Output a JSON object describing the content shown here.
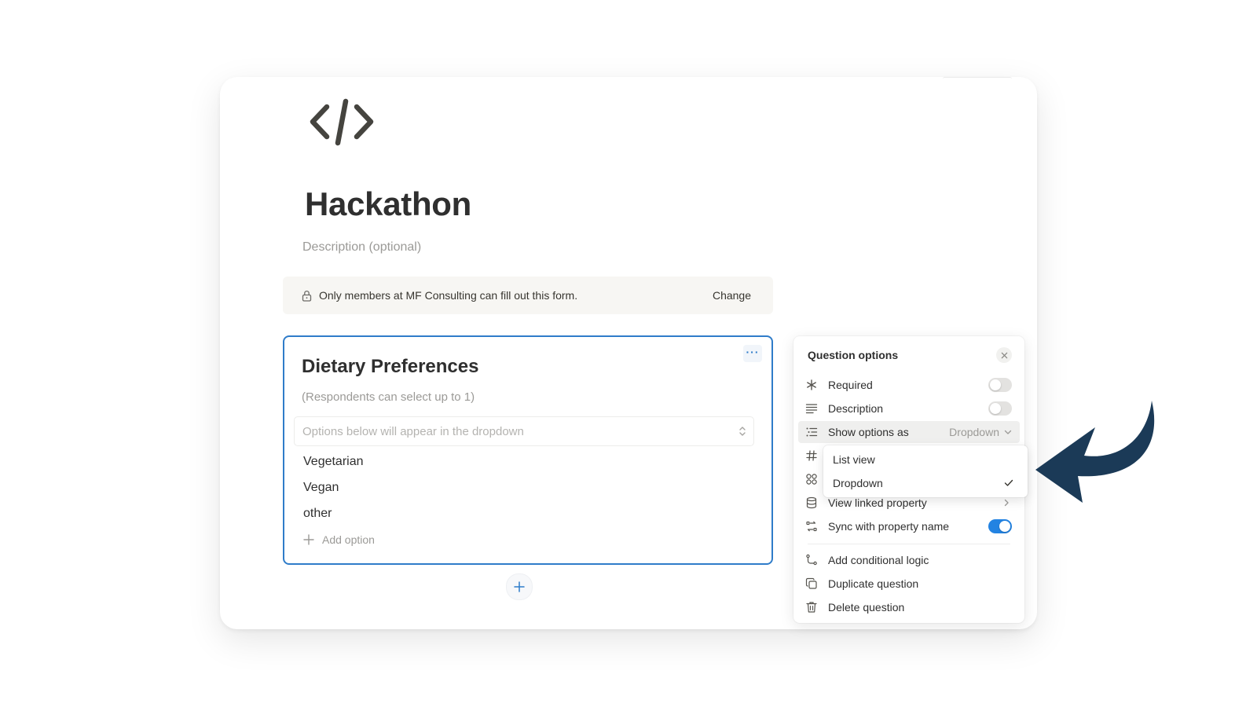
{
  "form": {
    "title": "Hackathon",
    "description_placeholder": "Description (optional)",
    "access_notice": "Only members at MF Consulting can fill out this form.",
    "access_change_label": "Change",
    "icon": "code-brackets-icon"
  },
  "question": {
    "title": "Dietary Preferences",
    "hint": "(Respondents can select up to 1)",
    "dropdown_placeholder": "Options below will appear in the dropdown",
    "options": [
      "Vegetarian",
      "Vegan",
      "other"
    ],
    "add_option_label": "Add option",
    "more_label": "···"
  },
  "question_options": {
    "title": "Question options",
    "required_label": "Required",
    "required_on": false,
    "description_label": "Description",
    "description_on": false,
    "show_options_label": "Show options as",
    "show_options_value": "Dropdown",
    "view_linked_label": "View linked property",
    "sync_label": "Sync with property name",
    "sync_on": true,
    "conditional_label": "Add conditional logic",
    "duplicate_label": "Duplicate question",
    "delete_label": "Delete question"
  },
  "show_options_menu": {
    "items": [
      "List view",
      "Dropdown"
    ],
    "selected": "Dropdown"
  },
  "colors": {
    "accent": "#2383e2",
    "card_border": "#2f7cc9",
    "arrow": "#1b3a57"
  }
}
